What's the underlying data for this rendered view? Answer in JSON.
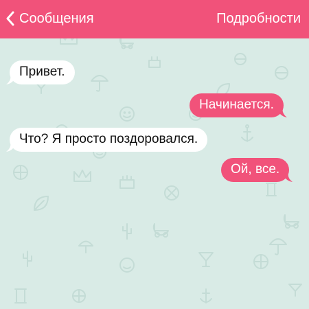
{
  "navbar": {
    "back_label": "Сообщения",
    "details_label": "Подробности"
  },
  "messages": [
    {
      "direction": "incoming",
      "text": "Привет."
    },
    {
      "direction": "outgoing",
      "text": "Начинается."
    },
    {
      "direction": "incoming",
      "text": "Что? Я просто поздоровался."
    },
    {
      "direction": "outgoing",
      "text": "Ой, все."
    }
  ],
  "colors": {
    "accent": "#f1527a",
    "background": "#d9ebe6",
    "incoming_bubble": "#ffffff",
    "pattern": "#c4dcd6"
  },
  "icons": {
    "back": "chevron-left-icon",
    "background_pattern": [
      "smiley-icon",
      "ball-icon",
      "umbrella-icon",
      "crown-icon",
      "cake-icon",
      "stroller-icon",
      "cactus-icon",
      "column-icon",
      "anchor-icon",
      "leaf-icon",
      "drink-icon"
    ]
  }
}
